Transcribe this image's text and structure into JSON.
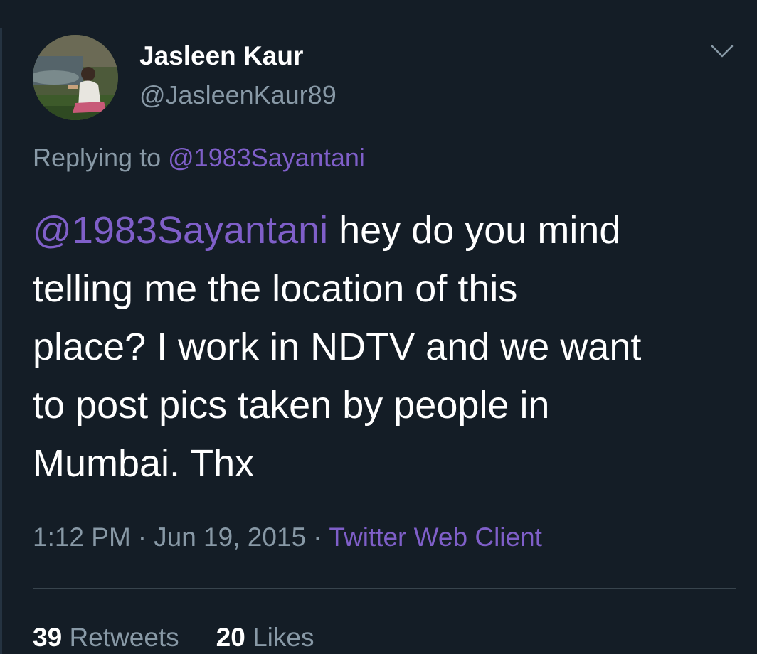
{
  "tweet": {
    "author": {
      "display_name": "Jasleen Kaur",
      "handle": "@JasleenKaur89",
      "avatar": "profile-photo"
    },
    "replying_prefix": "Replying to",
    "replying_to": "@1983Sayantani",
    "text": {
      "mention": "@1983Sayantani",
      "line1_rest": " hey do you mind",
      "line2": "telling me the location of this",
      "line3": "place? I work in NDTV and we want",
      "line4": "to post pics taken by people in",
      "line5": "Mumbai. Thx"
    },
    "time": "1:12 PM",
    "date": "Jun 19, 2015",
    "separator": "·",
    "source": "Twitter Web Client",
    "retweets": {
      "count": "39",
      "label": "Retweets"
    },
    "likes": {
      "count": "20",
      "label": "Likes"
    },
    "menu_icon": "chevron-down-icon"
  },
  "colors": {
    "background": "#141d26",
    "text": "#ffffff",
    "secondary": "#8899a6",
    "link": "#7f5fc9",
    "divider": "#38444d"
  }
}
